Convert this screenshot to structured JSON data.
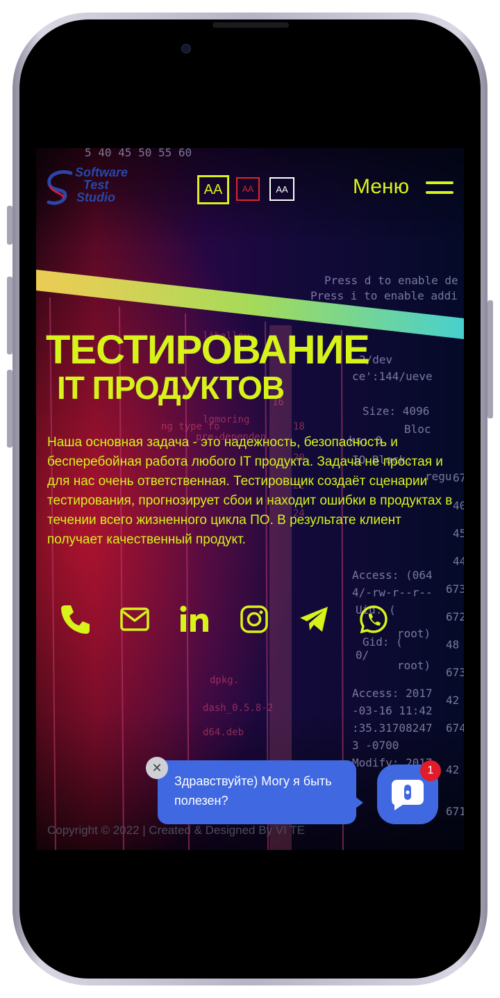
{
  "header": {
    "logo_lines": [
      "Software",
      "Test",
      "Studio"
    ],
    "font_size_large": "AA",
    "font_size_medium": "AA",
    "font_size_small": "AA",
    "menu_label": "Меню"
  },
  "hero": {
    "title_line1": "ТЕСТИРОВАНИЕ",
    "title_line2": "IT ПРОДУКТОВ",
    "description": "Наша основная задача - это надежность, безопасность и бесперебойная работа любого IT продукта. Задача не простая и для нас очень ответственная. Тестировщик создаёт сценарии тестирования, прогнозирует сбои и находит ошибки в продуктах в течении всего жизненного цикла ПО. В результате клиент получает качественный продукт."
  },
  "socials": [
    "phone-icon",
    "mail-icon",
    "linkedin-icon",
    "instagram-icon",
    "telegram-icon",
    "whatsapp-icon"
  ],
  "footer": {
    "copyright": "Copyright © 2022 | Created & Designed By VI TE"
  },
  "chat": {
    "greeting": "Здравствуйте) Могу я быть полезен?",
    "close_symbol": "✕",
    "unread_count": "1"
  },
  "colors": {
    "accent": "#d8f31a",
    "chat_blue": "#4068e0",
    "badge_red": "#e01b2a",
    "medium_button": "#e0262f"
  }
}
